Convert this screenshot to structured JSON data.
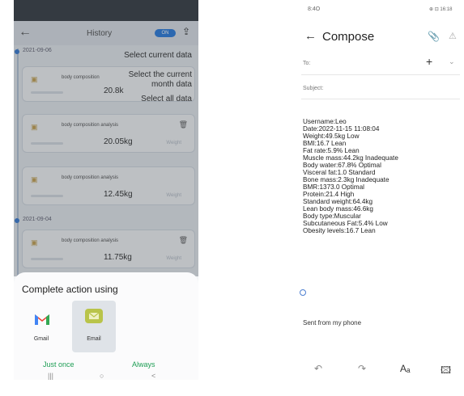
{
  "left_phone": {
    "header": {
      "back_icon": "arrow-left",
      "title": "History",
      "toggle_label": "ON",
      "share_icon": "export-icon"
    },
    "groups": [
      {
        "date": "2021-09-06"
      },
      {
        "date": "2021-09-04"
      }
    ],
    "records": [
      {
        "name": "body composition",
        "value": "20.8k",
        "unit_label": ""
      },
      {
        "name": "body composition analysis",
        "value": "20.05kg",
        "unit_label": "Weight"
      },
      {
        "name": "body composition analysis",
        "value": "12.45kg",
        "unit_label": "Weight"
      },
      {
        "name": "body composition analysis",
        "value": "11.75kg",
        "unit_label": "Weight"
      }
    ],
    "menu": {
      "item1": "Select current data",
      "item2": "Select the current",
      "item2b": "month data",
      "item3": "Select all data"
    },
    "sheet": {
      "title": "Complete action using",
      "apps": [
        {
          "label": "Gmail",
          "icon": "gmail-icon"
        },
        {
          "label": "Email",
          "icon": "email-icon"
        }
      ],
      "just_once": "Just once",
      "always": "Always"
    },
    "nav": {
      "recent": "|||",
      "home": "○",
      "back": "<"
    }
  },
  "right_phone": {
    "status": {
      "left": "8:4O",
      "right": "⊕ ⊡ 16:18"
    },
    "title": "Compose",
    "to_label": "To:",
    "subject_label": "Subject:",
    "body_lines": [
      "Username:Leo",
      "Date:2022-11-15 11:08:04",
      "Weight:49.5kg  Low",
      "BMI:16.7  Lean",
      "Fat rate:5.9%  Lean",
      "Muscle mass:44.2kg  Inadequate",
      "Body water:67.8%  Optimal",
      "Visceral fat:1.0  Standard",
      "Bone mass:2.3kg  Inadequate",
      "BMR:1373.0  Optimal",
      "Protein:21.4  High",
      "Standard weight:64.4kg",
      "Lean body mass:46.6kg",
      "Body type:Muscular",
      "Subcutaneous Fat:5.4%  Low",
      "Obesity levels:16.7  Lean"
    ],
    "signature": "Sent from my phone",
    "icons": [
      "undo-icon",
      "redo-icon",
      "text-format-icon",
      "image-icon"
    ]
  }
}
